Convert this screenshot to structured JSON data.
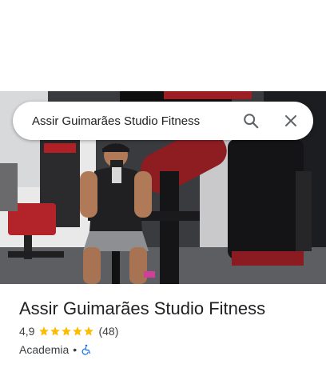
{
  "search": {
    "query": "Assir Guimarães Studio Fitness",
    "search_icon": "search-icon",
    "close_icon": "close-icon"
  },
  "place": {
    "name": "Assir Guimarães Studio Fitness",
    "rating": "4,9",
    "rating_stars": 5,
    "reviews": "(48)",
    "category": "Academia",
    "separator": "•",
    "accessibility_icon": "wheelchair-icon"
  },
  "colors": {
    "star": "#fbbc04",
    "accessibility": "#1a73e8",
    "text_primary": "#202124",
    "text_secondary": "#3c4043"
  }
}
